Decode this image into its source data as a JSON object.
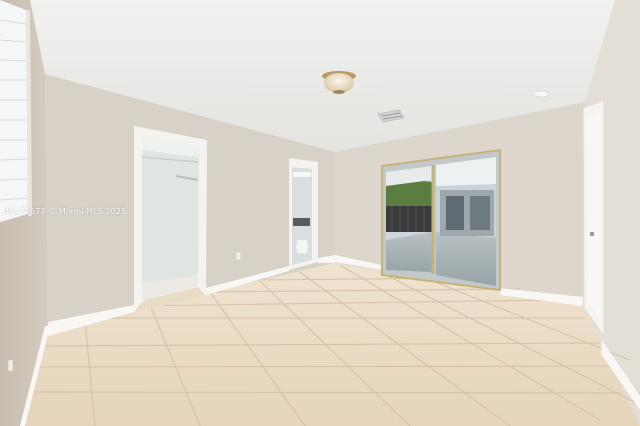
{
  "photo": {
    "subject": "empty room with tile floor",
    "watermark_text": "41172677 © Miami MLS 2025"
  },
  "palette": {
    "ceiling": "#ececea",
    "left_wall": "#d2c9bd",
    "back_wall": "#dad4cb",
    "right_wall": "#e2ddd5",
    "floor": "#e8d9c4",
    "tile_grout": "#d6c3a8",
    "baseboard": "#f7f6f2",
    "trim": "#f4f3ef",
    "closet_interior": "#dfe4e1",
    "patio": "#a9b3b6",
    "greenery": "#5b7d3f"
  }
}
